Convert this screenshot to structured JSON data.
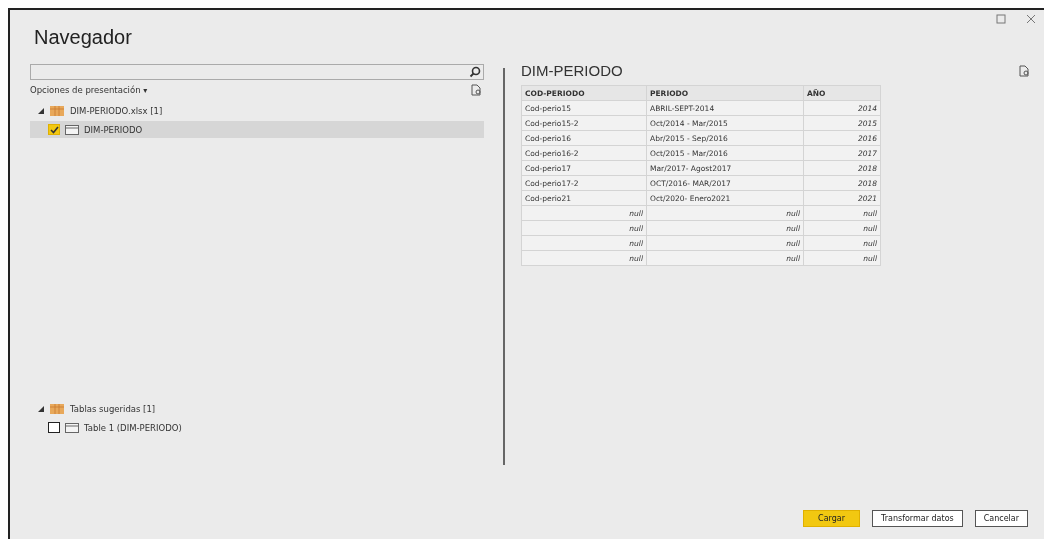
{
  "window": {
    "title": "Navegador"
  },
  "display_options": {
    "label": "Opciones de presentación",
    "caret": "▾"
  },
  "trees": [
    {
      "label": "DIM-PERIODO.xlsx [1]",
      "kind": "folder",
      "expanded": true,
      "children": [
        {
          "label": "DIM-PERIODO",
          "kind": "table",
          "checked": true,
          "selected": true
        }
      ]
    },
    {
      "label": "Tablas sugeridas [1]",
      "kind": "folder",
      "expanded": true,
      "children": [
        {
          "label": "Table 1 (DIM-PERIODO)",
          "kind": "table",
          "checked": false,
          "selected": false
        }
      ]
    }
  ],
  "preview": {
    "title": "DIM-PERIODO",
    "columns": [
      "COD-PERIODO",
      "PERIODO",
      "AÑO"
    ],
    "rows": [
      [
        "Cod-perio15",
        "ABRIL-SEPT-2014",
        "2014"
      ],
      [
        "Cod-perio15-2",
        "Oct/2014 - Mar/2015",
        "2015"
      ],
      [
        "Cod-perio16",
        "Abr/2015 - Sep/2016",
        "2016"
      ],
      [
        "Cod-perio16-2",
        "Oct/2015 - Mar/2016",
        "2017"
      ],
      [
        "Cod-perio17",
        "Mar/2017- Agost2017",
        "2018"
      ],
      [
        "Cod-perio17-2",
        "OCT/2016- MAR/2017",
        "2018"
      ],
      [
        "Cod-perio21",
        "Oct/2020- Enero2021",
        "2021"
      ],
      [
        "null",
        "null",
        "null"
      ],
      [
        "null",
        "null",
        "null"
      ],
      [
        "null",
        "null",
        "null"
      ],
      [
        "null",
        "null",
        "null"
      ]
    ]
  },
  "buttons": [
    {
      "label": "Cargar",
      "primary": true
    },
    {
      "label": "Transformar datos",
      "primary": false
    },
    {
      "label": "Cancelar",
      "primary": false
    }
  ]
}
